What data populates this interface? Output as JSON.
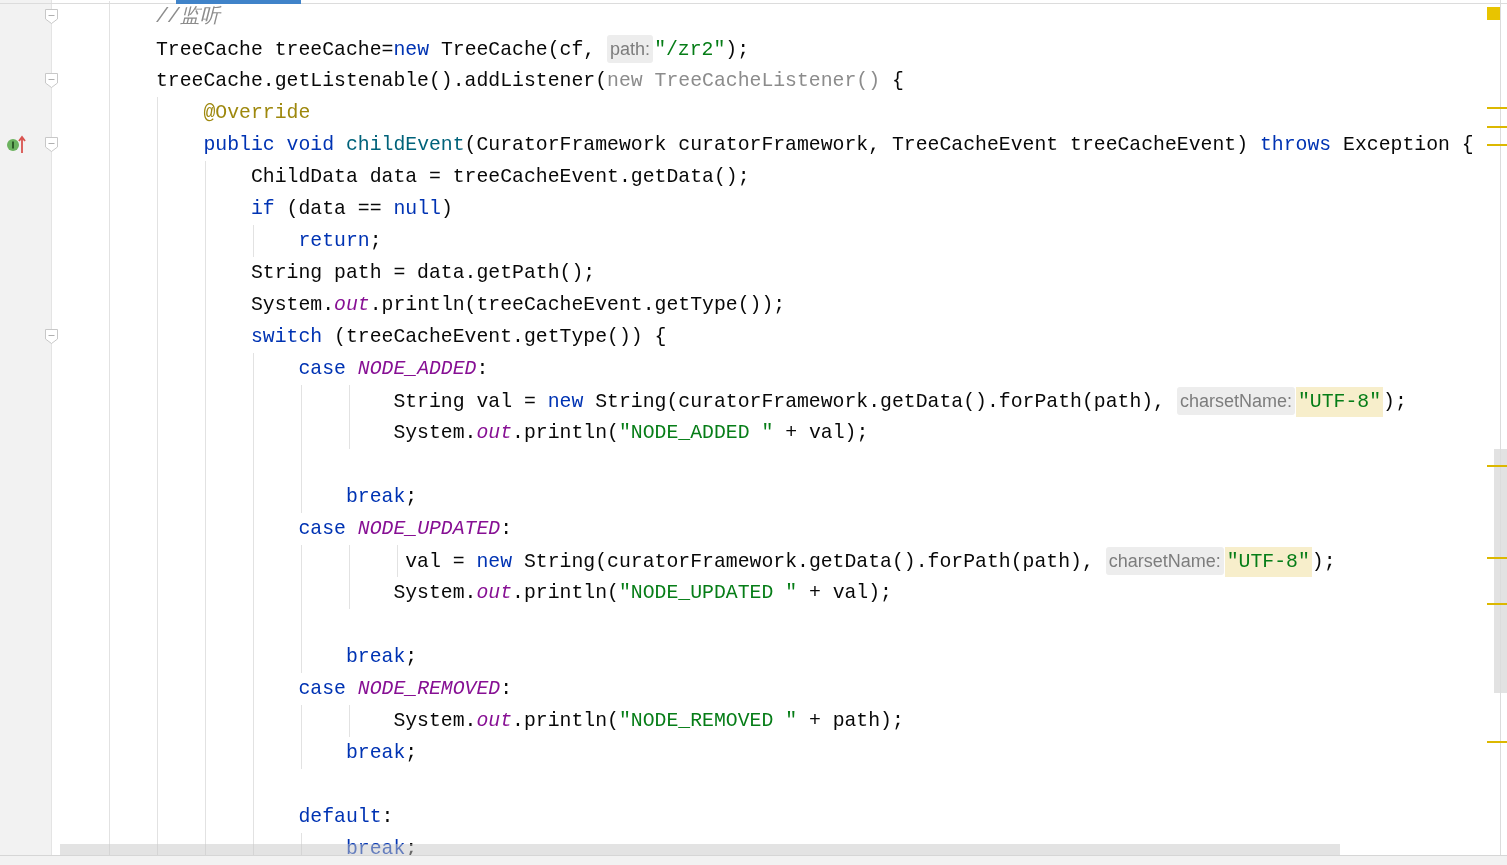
{
  "lines": [
    {
      "kind": "code",
      "fold": true,
      "tokens": [
        {
          "t": "        //监听",
          "kind": "comment"
        }
      ]
    },
    {
      "kind": "code",
      "tokens": [
        {
          "t": "        TreeCache treeCache=",
          "kind": "plain"
        },
        {
          "t": "new",
          "kind": "keyword"
        },
        {
          "t": " TreeCache(cf, ",
          "kind": "plain"
        },
        {
          "t": "path:",
          "kind": "hint"
        },
        {
          "t": "\"/zr2\"",
          "kind": "string"
        },
        {
          "t": ");",
          "kind": "plain"
        }
      ]
    },
    {
      "kind": "code",
      "fold": true,
      "tokens": [
        {
          "t": "        treeCache.getListenable().addListener(",
          "kind": "plain"
        },
        {
          "t": "new TreeCacheListener()",
          "kind": "muted"
        },
        {
          "t": " {",
          "kind": "plain"
        }
      ]
    },
    {
      "kind": "code",
      "tokens": [
        {
          "t": "            @Override",
          "kind": "annotation"
        }
      ]
    },
    {
      "kind": "code",
      "fold": true,
      "override": true,
      "tokens": [
        {
          "t": "            public void",
          "kind": "keyword"
        },
        {
          "t": " childEvent",
          "kind": "decl"
        },
        {
          "t": "(CuratorFramework curatorFramework, TreeCacheEvent treeCacheEvent) ",
          "kind": "plain"
        },
        {
          "t": "throws",
          "kind": "keyword"
        },
        {
          "t": " Exception {",
          "kind": "plain"
        }
      ]
    },
    {
      "kind": "code",
      "tokens": [
        {
          "t": "                ChildData data = treeCacheEvent.getData();",
          "kind": "plain"
        }
      ]
    },
    {
      "kind": "code",
      "tokens": [
        {
          "t": "                if",
          "kind": "keyword"
        },
        {
          "t": " (data == ",
          "kind": "plain"
        },
        {
          "t": "null",
          "kind": "keyword"
        },
        {
          "t": ")",
          "kind": "plain"
        }
      ]
    },
    {
      "kind": "code",
      "tokens": [
        {
          "t": "                    return",
          "kind": "keyword"
        },
        {
          "t": ";",
          "kind": "plain"
        }
      ]
    },
    {
      "kind": "code",
      "tokens": [
        {
          "t": "                String path = data.getPath();",
          "kind": "plain"
        }
      ]
    },
    {
      "kind": "code",
      "tokens": [
        {
          "t": "                System.",
          "kind": "plain"
        },
        {
          "t": "out",
          "kind": "field"
        },
        {
          "t": ".println(treeCacheEvent.getType());",
          "kind": "plain"
        }
      ]
    },
    {
      "kind": "code",
      "fold": true,
      "tokens": [
        {
          "t": "                switch",
          "kind": "keyword"
        },
        {
          "t": " (treeCacheEvent.getType()) {",
          "kind": "plain"
        }
      ]
    },
    {
      "kind": "code",
      "tokens": [
        {
          "t": "                    case",
          "kind": "keyword"
        },
        {
          "t": " NODE_ADDED",
          "kind": "field"
        },
        {
          "t": ":",
          "kind": "plain"
        }
      ]
    },
    {
      "kind": "code",
      "tokens": [
        {
          "t": "                            String val = ",
          "kind": "plain"
        },
        {
          "t": "new",
          "kind": "keyword"
        },
        {
          "t": " String(curatorFramework.getData().forPath(path), ",
          "kind": "plain"
        },
        {
          "t": "charsetName:",
          "kind": "hint"
        },
        {
          "t": "\"UTF-8\"",
          "kind": "highlight"
        },
        {
          "t": ");",
          "kind": "plain"
        }
      ]
    },
    {
      "kind": "code",
      "tokens": [
        {
          "t": "                            System.",
          "kind": "plain"
        },
        {
          "t": "out",
          "kind": "field"
        },
        {
          "t": ".println(",
          "kind": "plain"
        },
        {
          "t": "\"NODE_ADDED \"",
          "kind": "string"
        },
        {
          "t": " + val);",
          "kind": "plain"
        }
      ]
    },
    {
      "kind": "blank"
    },
    {
      "kind": "code",
      "tokens": [
        {
          "t": "                        break",
          "kind": "keyword"
        },
        {
          "t": ";",
          "kind": "plain"
        }
      ]
    },
    {
      "kind": "code",
      "tokens": [
        {
          "t": "                    case",
          "kind": "keyword"
        },
        {
          "t": " NODE_UPDATED",
          "kind": "field"
        },
        {
          "t": ":",
          "kind": "plain"
        }
      ]
    },
    {
      "kind": "code",
      "tokens": [
        {
          "t": "                             val = ",
          "kind": "plain"
        },
        {
          "t": "new",
          "kind": "keyword"
        },
        {
          "t": " String(curatorFramework.getData().forPath(path), ",
          "kind": "plain"
        },
        {
          "t": "charsetName:",
          "kind": "hint"
        },
        {
          "t": "\"UTF-8\"",
          "kind": "highlight"
        },
        {
          "t": ");",
          "kind": "plain"
        }
      ]
    },
    {
      "kind": "code",
      "tokens": [
        {
          "t": "                            System.",
          "kind": "plain"
        },
        {
          "t": "out",
          "kind": "field"
        },
        {
          "t": ".println(",
          "kind": "plain"
        },
        {
          "t": "\"NODE_UPDATED \"",
          "kind": "string"
        },
        {
          "t": " + val);",
          "kind": "plain"
        }
      ]
    },
    {
      "kind": "blank"
    },
    {
      "kind": "code",
      "tokens": [
        {
          "t": "                        break",
          "kind": "keyword"
        },
        {
          "t": ";",
          "kind": "plain"
        }
      ]
    },
    {
      "kind": "code",
      "tokens": [
        {
          "t": "                    case",
          "kind": "keyword"
        },
        {
          "t": " NODE_REMOVED",
          "kind": "field"
        },
        {
          "t": ":",
          "kind": "plain"
        }
      ]
    },
    {
      "kind": "code",
      "tokens": [
        {
          "t": "                            System.",
          "kind": "plain"
        },
        {
          "t": "out",
          "kind": "field"
        },
        {
          "t": ".println(",
          "kind": "plain"
        },
        {
          "t": "\"NODE_REMOVED \"",
          "kind": "string"
        },
        {
          "t": " + path);",
          "kind": "plain"
        }
      ]
    },
    {
      "kind": "code",
      "tokens": [
        {
          "t": "                        break",
          "kind": "keyword"
        },
        {
          "t": ";",
          "kind": "plain"
        }
      ]
    },
    {
      "kind": "blank"
    },
    {
      "kind": "code",
      "tokens": [
        {
          "t": "                    default",
          "kind": "keyword"
        },
        {
          "t": ":",
          "kind": "plain"
        }
      ]
    },
    {
      "kind": "code",
      "tokens": [
        {
          "t": "                        break",
          "kind": "keyword"
        },
        {
          "t": ";",
          "kind": "plain"
        }
      ]
    }
  ]
}
